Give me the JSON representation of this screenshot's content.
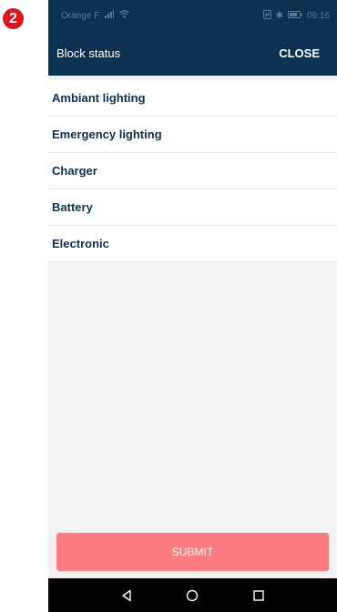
{
  "annotation": {
    "step": "2"
  },
  "status_bar": {
    "carrier": "Orange F",
    "time": "09:16",
    "icons": [
      "signal-icon",
      "wifi-icon",
      "nfc-icon",
      "bluetooth-icon",
      "battery-icon"
    ]
  },
  "app_bar": {
    "title": "Block status",
    "close_label": "CLOSE"
  },
  "list": {
    "items": [
      {
        "label": "Ambiant lighting"
      },
      {
        "label": "Emergency lighting"
      },
      {
        "label": "Charger"
      },
      {
        "label": "Battery"
      },
      {
        "label": "Electronic"
      }
    ]
  },
  "footer": {
    "submit_label": "SUBMIT"
  },
  "nav": {
    "icons": [
      "back-icon",
      "home-icon",
      "recents-icon"
    ]
  },
  "colors": {
    "primary": "#0b3250",
    "submit_disabled": "#ff7b82",
    "badge": "#e0141e"
  }
}
